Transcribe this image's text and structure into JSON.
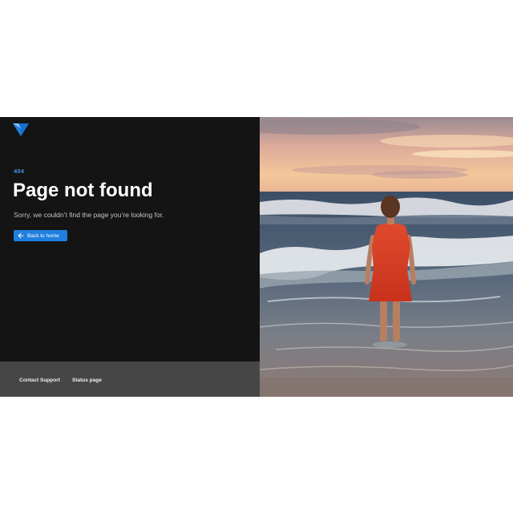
{
  "brand": {
    "logo_icon": "v-triangle-logo-icon",
    "accent_color": "#1f7fe0"
  },
  "error": {
    "code": "404",
    "title": "Page not found",
    "description": "Sorry, we couldn’t find the page you’re looking for."
  },
  "actions": {
    "back_label": "Back to home",
    "back_icon": "arrow-left-icon"
  },
  "footer": {
    "links": [
      "Contact Support",
      "Status page"
    ]
  },
  "hero_image": {
    "subject": "woman-in-red-dress-at-sea-photo"
  }
}
